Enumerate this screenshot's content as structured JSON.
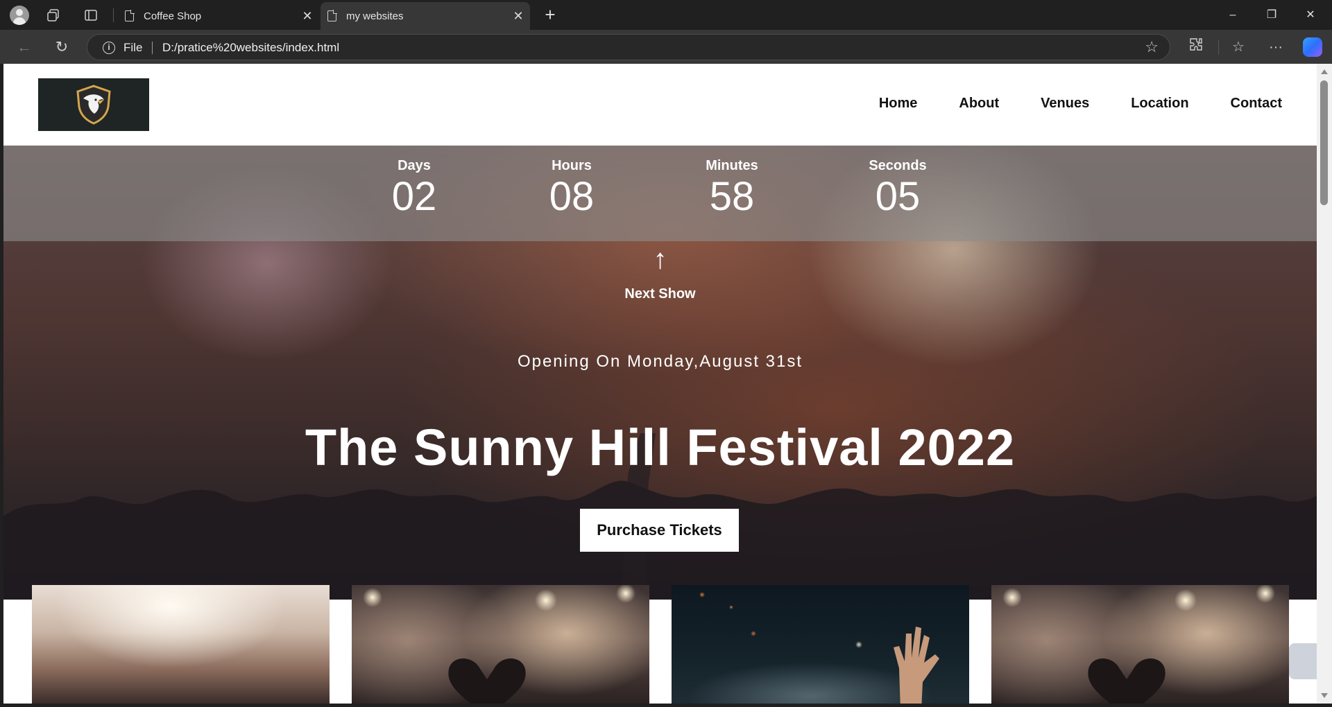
{
  "browser": {
    "tabs": [
      {
        "title": "Coffee Shop",
        "active": false
      },
      {
        "title": "my websites",
        "active": true
      }
    ],
    "address": {
      "scheme_label": "File",
      "url": "D:/pratice%20websites/index.html"
    },
    "icons": [
      "profile-avatar",
      "workspaces-icon",
      "tab-actions-icon",
      "back-icon",
      "refresh-icon",
      "info-icon",
      "favorite-star-icon",
      "extensions-icon",
      "favorites-icon",
      "more-icon",
      "copilot-icon",
      "minimize-icon",
      "restore-icon",
      "close-icon"
    ]
  },
  "site": {
    "nav": [
      {
        "label": "Home"
      },
      {
        "label": "About"
      },
      {
        "label": "Venues"
      },
      {
        "label": "Location"
      },
      {
        "label": "Contact"
      }
    ],
    "countdown": [
      {
        "label": "Days",
        "value": "02"
      },
      {
        "label": "Hours",
        "value": "08"
      },
      {
        "label": "Minutes",
        "value": "58"
      },
      {
        "label": "Seconds",
        "value": "05"
      }
    ],
    "next_arrow": "↑",
    "next_label": "Next Show",
    "opening": "Opening On Monday,August 31st",
    "title": "The Sunny Hill Festival 2022",
    "cta": "Purchase Tickets"
  },
  "colors": {
    "header_bg": "#ffffff",
    "logo_bg": "#1f2424",
    "countdown_bar": "rgba(140,140,140,0.62)",
    "chrome_bg": "#202020"
  }
}
